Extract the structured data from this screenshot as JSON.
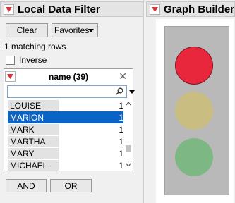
{
  "filter_panel": {
    "title": "Local Data Filter",
    "clear_label": "Clear",
    "favorites_label": "Favorites",
    "matching_rows": "1 matching rows",
    "inverse_label": "Inverse",
    "inverse_checked": false,
    "column_box": {
      "title": "name (39)",
      "search_value": "",
      "rows": [
        {
          "name": "LOUISE",
          "count": "1",
          "selected": false
        },
        {
          "name": "MARION",
          "count": "1",
          "selected": true
        },
        {
          "name": "MARK",
          "count": "1",
          "selected": false
        },
        {
          "name": "MARTHA",
          "count": "1",
          "selected": false
        },
        {
          "name": "MARY",
          "count": "1",
          "selected": false
        },
        {
          "name": "MICHAEL",
          "count": "1",
          "selected": false
        }
      ]
    },
    "and_label": "AND",
    "or_label": "OR"
  },
  "graph_panel": {
    "title": "Graph Builder",
    "lights": [
      {
        "name": "red",
        "color": "#e8273d",
        "active": true
      },
      {
        "name": "yellow",
        "color": "#c9bd81",
        "active": false
      },
      {
        "name": "green",
        "color": "#7db784",
        "active": false
      }
    ]
  },
  "colors": {
    "disclosure_triangle": "#e0303a",
    "selection": "#0a64c8",
    "housing": "#b9b9b9"
  }
}
